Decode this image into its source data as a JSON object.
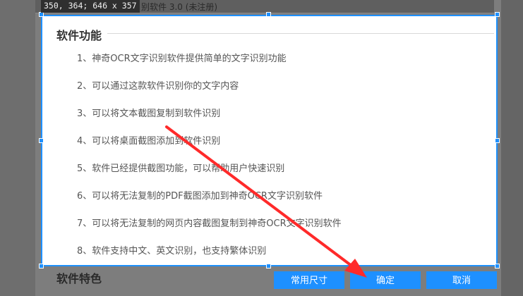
{
  "app": {
    "title_fragment": "别软件 3.0 (未注册)"
  },
  "selection_info": "350, 364; 646 x 357",
  "panel": {
    "section_title": "软件功能",
    "items": [
      "1、神奇OCR文字识别软件提供简单的文字识别功能",
      "2、可以通过这款软件识别你的文字内容",
      "3、可以将文本截图复制到软件识别",
      "4、可以将桌面截图添加到软件识别",
      "5、软件已经提供截图功能，可以帮助用户快速识别",
      "6、可以将无法复制的PDF截图添加到神奇OCR文字识别软件",
      "7、可以将无法复制的网页内容截图复制到神奇OCR文字识别软件",
      "8、软件支持中文、英文识别，也支持繁体识别"
    ]
  },
  "bottom_section_title": "软件特色",
  "toolbar": {
    "common_size_label": "常用尺寸",
    "confirm_label": "确定",
    "cancel_label": "取消"
  },
  "colors": {
    "accent": "#1e90ff",
    "annotation_arrow": "#ff2a2a"
  }
}
